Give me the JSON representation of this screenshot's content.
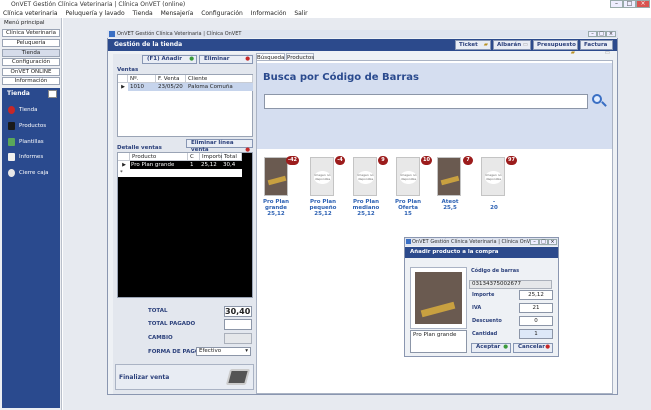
{
  "titlebar": {
    "title": "OnVET Gestión Clínica Veterinaria | Clínica OnVET (online)"
  },
  "menu": [
    "Clínica veterinaria",
    "Peluquería y lavado",
    "Tienda",
    "Mensajería",
    "Configuración",
    "Información",
    "Salir"
  ],
  "sidebar": {
    "heading": "Menú principal",
    "items": [
      "Clínica Veterinaria",
      "Peluquería",
      "Tienda",
      "Configuración",
      "OnVET ONLINE",
      "Información"
    ],
    "tienda": {
      "title": "Tienda",
      "items": [
        "Tienda",
        "Productos",
        "Plantillas",
        "Informes",
        "Cierre caja"
      ]
    }
  },
  "window": {
    "title": "OnVET Gestión Clínica Veterinaria | Clínica OnVET",
    "header": "Gestión de la tienda",
    "top_buttons": [
      "Ticket",
      "Albarán",
      "Presupuesto",
      "Factura"
    ]
  },
  "ventas": {
    "add_label": "(F1) Añadir",
    "delete_label": "Eliminar",
    "label": "Ventas",
    "columns": [
      "Nº. ticket",
      "F. Venta",
      "Cliente"
    ],
    "rows": [
      {
        "ticket": "1010",
        "fecha": "23/05/20",
        "cliente": "Paloma Comuña"
      }
    ]
  },
  "detalle": {
    "delete_line_label": "Eliminar línea venta",
    "label": "Detalle ventas",
    "columns": [
      "Producto",
      "C",
      "Importe",
      "Total"
    ],
    "rows": [
      {
        "producto": "Pro Plan grande",
        "c": "1",
        "importe": "25,12",
        "total": "30,4"
      }
    ],
    "new_row_marker": "*"
  },
  "totales": {
    "total_label": "TOTAL",
    "total_value": "30,40",
    "pagado_label": "TOTAL PAGADO",
    "cambio_label": "CAMBIO",
    "forma_label": "FORMA DE PAGO",
    "forma_value": "Efectivo",
    "finalizar_label": "Finalizar venta"
  },
  "tabs": [
    "Búsqueda",
    "Productos"
  ],
  "search": {
    "title": "Busca por Código de Barras",
    "value": ""
  },
  "products": [
    {
      "name": "Pro Plan grande",
      "price": "25,12",
      "badge": "-42",
      "has_image": true
    },
    {
      "name": "Pro Plan pequeño",
      "price": "25,12",
      "badge": "-4",
      "has_image": false
    },
    {
      "name": "Pro Plan mediano",
      "price": "25,12",
      "badge": "9",
      "has_image": false
    },
    {
      "name": "Pro Plan Oferta",
      "price": "15",
      "badge": "10",
      "has_image": false
    },
    {
      "name": "Ateot",
      "price": "25,5",
      "badge": "7",
      "has_image": true
    },
    {
      "name": "-",
      "price": "20",
      "badge": "97",
      "has_image": false
    }
  ],
  "no_image_text": "Imagen no disponible",
  "dialog": {
    "title": "OnVET Gestión Clínica Veterinaria | Clínica OnV...",
    "header": "Añadir producto a la compra",
    "barcode_label": "Código de barras",
    "barcode_value": "03134375002677",
    "product_name": "Pro Plan grande",
    "importe_label": "Importe",
    "importe_value": "25,12",
    "iva_label": "IVA",
    "iva_value": "21",
    "descuento_label": "Descuento",
    "descuento_value": "0",
    "cantidad_label": "Cantidad",
    "cantidad_value": "1",
    "accept_label": "Aceptar",
    "cancel_label": "Cancelar"
  },
  "colors": {
    "navy": "#2c4a8c",
    "accent_blue": "#2a5fb2",
    "badge_red": "#9c1c1c",
    "search_bg": "#d5def0"
  }
}
